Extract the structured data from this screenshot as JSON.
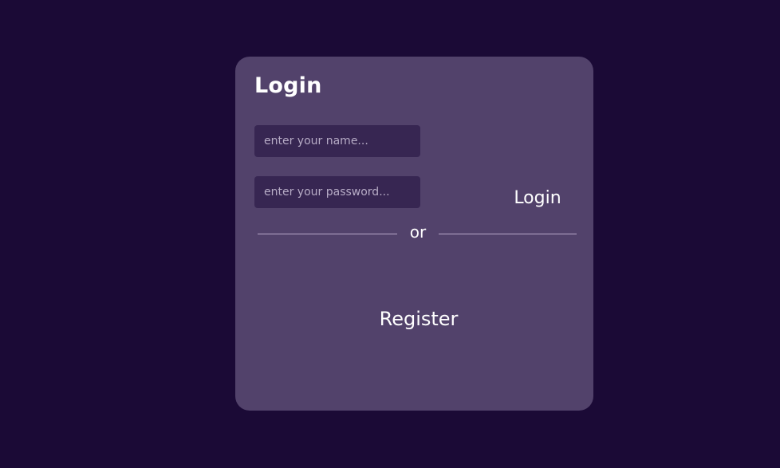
{
  "colors": {
    "page_background": "#1b0a36",
    "card_background": "#52426b",
    "input_background": "#372652",
    "text": "#ffffff",
    "placeholder": "#b7acc6",
    "divider": "#b7a9c9"
  },
  "login_card": {
    "title": "Login",
    "name_input": {
      "placeholder": "enter your name...",
      "value": ""
    },
    "password_input": {
      "placeholder": "enter your password...",
      "value": ""
    },
    "login_button_label": "Login",
    "divider_text": "or",
    "register_button_label": "Register"
  }
}
